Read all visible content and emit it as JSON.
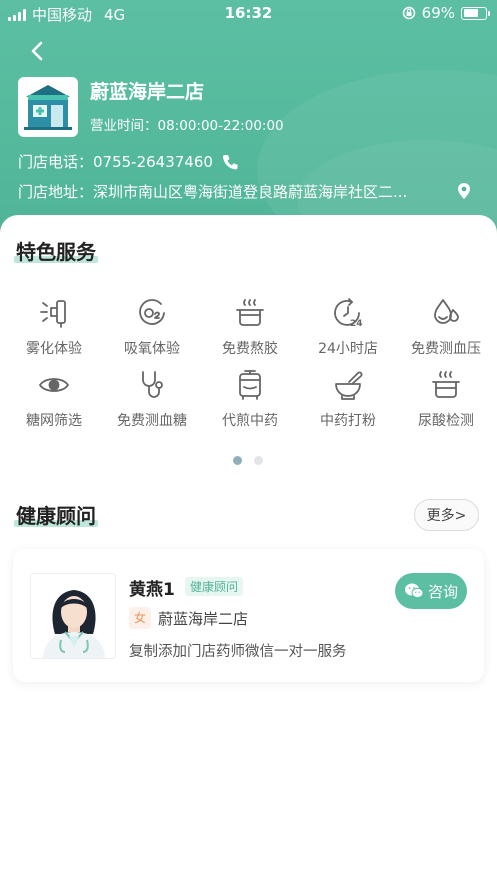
{
  "status_bar": {
    "carrier": "中国移动",
    "network": "4G",
    "time": "16:32",
    "battery": "69%",
    "battery_level": 0.69
  },
  "store": {
    "name": "蔚蓝海岸二店",
    "hours": "营业时间：08:00:00-22:00:00",
    "phone": "门店电话：0755-26437460",
    "address": "门店地址：深圳市南山区粤海街道登良路蔚蓝海岸社区二..."
  },
  "services": {
    "title": "特色服务",
    "items": [
      {
        "label": "雾化体验",
        "icon": "nebulizer-icon"
      },
      {
        "label": "吸氧体验",
        "icon": "oxygen-icon"
      },
      {
        "label": "免费熬胶",
        "icon": "pot-icon"
      },
      {
        "label": "24小时店",
        "icon": "clock-24-icon"
      },
      {
        "label": "免费测血压",
        "icon": "blood-drop-icon"
      },
      {
        "label": "糖网筛选",
        "icon": "eye-icon"
      },
      {
        "label": "免费测血糖",
        "icon": "stethoscope-icon"
      },
      {
        "label": "代煎中药",
        "icon": "herb-cooker-icon"
      },
      {
        "label": "中药打粉",
        "icon": "mortar-icon"
      },
      {
        "label": "尿酸检测",
        "icon": "steam-pot-icon"
      }
    ],
    "page_count": 2,
    "active_page": 0
  },
  "advisors": {
    "title": "健康顾问",
    "more_label": "更多>",
    "card": {
      "name": "黄燕1",
      "tag": "健康顾问",
      "gender": "女",
      "store": "蔚蓝海岸二店",
      "desc": "复制添加门店药师微信一对一服务",
      "consult_label": "咨询"
    }
  },
  "colors": {
    "brand": "#5cbfa3",
    "highlight": "#bfe6da"
  }
}
